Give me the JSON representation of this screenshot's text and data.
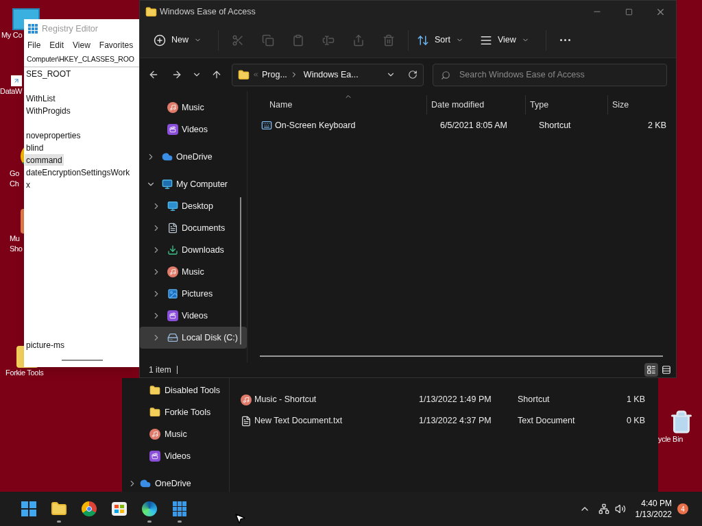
{
  "desktop": {
    "icons": [
      {
        "kind": "computer",
        "lines": [
          "My Co"
        ]
      },
      {
        "kind": "app",
        "lines": [
          "DataW"
        ]
      },
      {
        "kind": "chrome",
        "lines": [
          "Go",
          "Ch"
        ]
      },
      {
        "kind": "music",
        "lines": [
          "Mu",
          "Sho"
        ]
      },
      {
        "kind": "folder",
        "lines": [
          "Forkie Tools"
        ]
      },
      {
        "kind": "recycle",
        "lines": [
          "ycle Bin"
        ]
      }
    ]
  },
  "registry_editor": {
    "title": "Registry Editor",
    "menu": [
      "File",
      "Edit",
      "View",
      "Favorites"
    ],
    "address": "Computer\\HKEY_CLASSES_ROO",
    "keys": [
      {
        "label": "SES_ROOT",
        "selected": false
      },
      {
        "label": "WithList",
        "selected": false
      },
      {
        "label": "WithProgids",
        "selected": false
      },
      {
        "label": "noveproperties",
        "selected": false
      },
      {
        "label": "blind",
        "selected": false
      },
      {
        "label": "command",
        "selected": true
      },
      {
        "label": "dateEncryptionSettingsWork",
        "selected": false
      },
      {
        "label": "x",
        "selected": false
      },
      {
        "label": "picture-ms",
        "selected": false
      }
    ]
  },
  "explorer": {
    "title": "Windows Ease of Access",
    "toolbar": [
      {
        "kind": "new",
        "label": "New",
        "disabled": false
      },
      {
        "kind": "cut",
        "disabled": true
      },
      {
        "kind": "copy",
        "disabled": true
      },
      {
        "kind": "paste",
        "disabled": true
      },
      {
        "kind": "rename",
        "disabled": true
      },
      {
        "kind": "share",
        "disabled": true
      },
      {
        "kind": "delete",
        "disabled": true
      },
      {
        "kind": "sort",
        "label": "Sort",
        "disabled": false
      },
      {
        "kind": "view",
        "label": "View",
        "disabled": false
      },
      {
        "kind": "more",
        "disabled": false
      }
    ],
    "address": [
      "Prog...",
      "Windows Ea..."
    ],
    "search": {
      "placeholder": "Search Windows Ease of Access"
    },
    "nav": [
      {
        "kind": "music",
        "label": "Music",
        "selected": false
      },
      {
        "kind": "videos",
        "label": "Videos",
        "selected": false
      },
      {
        "kind": "cloud",
        "label": "OneDrive",
        "expanded": false,
        "selected": false
      },
      {
        "kind": "computer",
        "label": "My Computer",
        "expanded": true,
        "selected": false,
        "children": [
          {
            "kind": "desktop",
            "label": "Desktop",
            "selected": false
          },
          {
            "kind": "documents",
            "label": "Documents",
            "selected": false
          },
          {
            "kind": "downloads",
            "label": "Downloads",
            "selected": false
          },
          {
            "kind": "music",
            "label": "Music",
            "selected": false
          },
          {
            "kind": "pictures",
            "label": "Pictures",
            "selected": false
          },
          {
            "kind": "videos",
            "label": "Videos",
            "selected": false
          },
          {
            "kind": "disk",
            "label": "Local Disk (C:)",
            "selected": true
          }
        ]
      }
    ],
    "columns": [
      {
        "label": "Name",
        "sorted": true
      },
      {
        "label": "Date modified",
        "sorted": false
      },
      {
        "label": "Type",
        "sorted": false
      },
      {
        "label": "Size",
        "sorted": false
      }
    ],
    "rows": [
      {
        "kind": "keyboard",
        "name": "On-Screen Keyboard",
        "date": "6/5/2021 8:05 AM",
        "type": "Shortcut",
        "size": "2 KB"
      }
    ],
    "status": "1 item",
    "views": [
      {
        "kind": "details",
        "selected": true
      },
      {
        "kind": "tiles",
        "selected": false
      }
    ]
  },
  "background_explorer": {
    "nav": [
      {
        "kind": "folder",
        "label": "Disabled Tools"
      },
      {
        "kind": "folder",
        "label": "Forkie Tools"
      },
      {
        "kind": "music",
        "label": "Music"
      },
      {
        "kind": "videos",
        "label": "Videos"
      },
      {
        "kind": "cloud",
        "label": "OneDrive"
      }
    ],
    "rows": [
      {
        "kind": "music",
        "name": "Music - Shortcut",
        "date": "1/13/2022 1:49 PM",
        "type": "Shortcut",
        "size": "1 KB"
      },
      {
        "kind": "text",
        "name": "New Text Document.txt",
        "date": "1/13/2022 4:37 PM",
        "type": "Text Document",
        "size": "0 KB"
      }
    ]
  },
  "taskbar": {
    "apps": [
      {
        "kind": "start",
        "running": false
      },
      {
        "kind": "explorer",
        "running": true
      },
      {
        "kind": "chrome",
        "running": false
      },
      {
        "kind": "store",
        "running": false
      },
      {
        "kind": "edge",
        "running": true
      },
      {
        "kind": "cubes",
        "running": true
      }
    ],
    "time": "4:40 PM",
    "date": "1/13/2022",
    "notifications": "4"
  }
}
